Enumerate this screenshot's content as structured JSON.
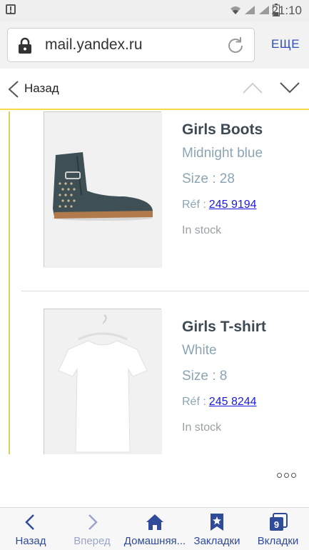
{
  "status_bar": {
    "time": "21:10"
  },
  "browser": {
    "url": "mail.yandex.ru",
    "more_label": "ЕЩЕ"
  },
  "mail_nav": {
    "back_label": "Назад"
  },
  "products": [
    {
      "title": "Girls Boots",
      "color": "Midnight blue",
      "size": "Size : 28",
      "ref_label": "Réf :",
      "ref_value": "245 9194",
      "stock": "In stock"
    },
    {
      "title": "Girls T-shirt",
      "color": "White",
      "size": "Size : 8",
      "ref_label": "Réf :",
      "ref_value": "245 8244",
      "stock": "In stock"
    }
  ],
  "bottom_bar": {
    "back": "Назад",
    "forward": "Вперед",
    "home": "Домашняя...",
    "bookmarks": "Закладки",
    "tabs": "Вкладки",
    "tabs_count": "9"
  },
  "colors": {
    "accent": "#2f4b99",
    "quote_line": "#d7d25a",
    "header_border": "#f5d94a",
    "link": "#1a1ae0"
  }
}
